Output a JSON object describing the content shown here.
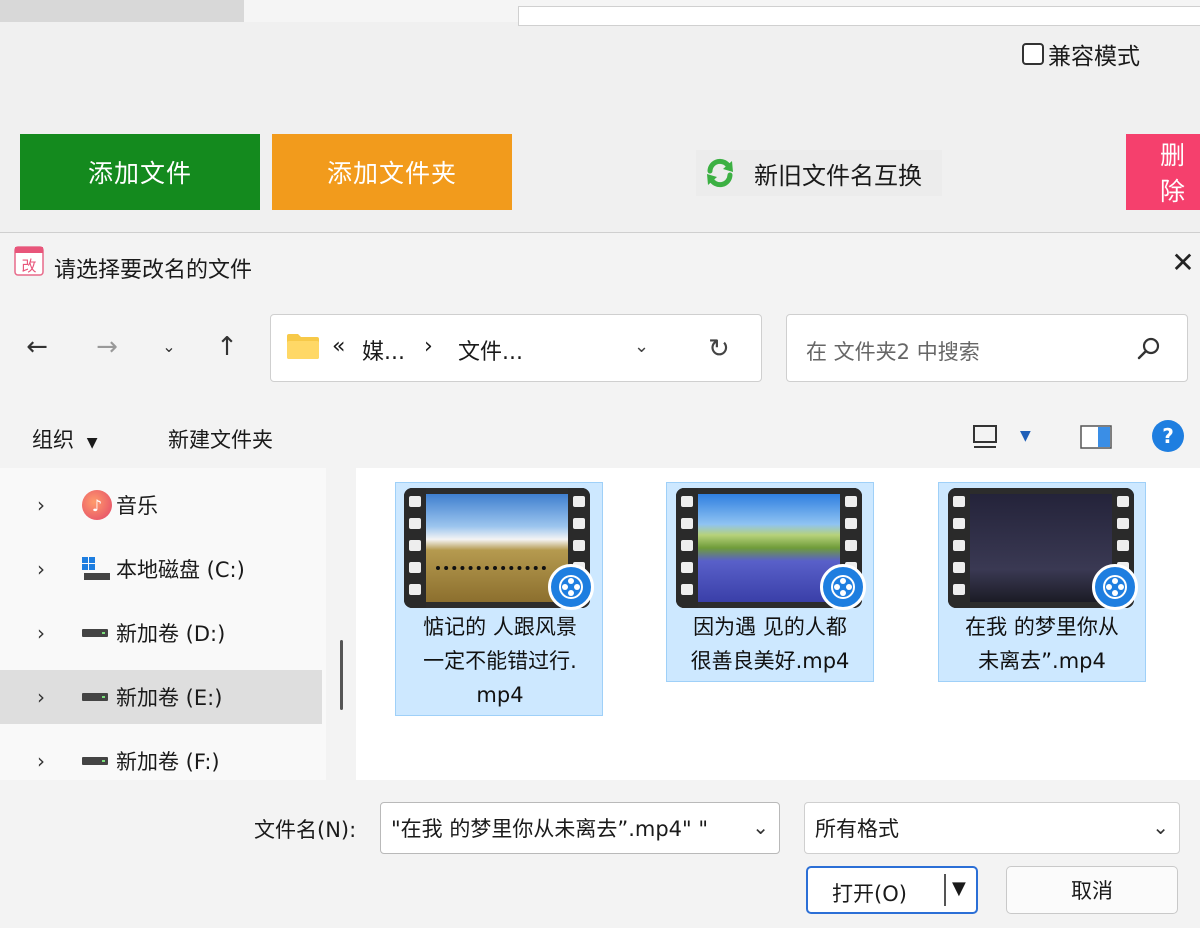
{
  "background_app": {
    "compat_mode_label": "兼容模式",
    "buttons": {
      "add_file": "添加文件",
      "add_folder": "添加文件夹",
      "swap_names": "新旧文件名互换",
      "delete_partial": "删除"
    },
    "colors": {
      "green": "#148a1e",
      "orange": "#f29b1c",
      "pink": "#f5406d"
    }
  },
  "dialog": {
    "title": "请选择要改名的文件",
    "address": {
      "prefix": "«",
      "segment1": "媒...",
      "separator": "›",
      "segment2": "文件..."
    },
    "search_placeholder": "在 文件夹2 中搜索",
    "toolbar": {
      "organize": "组织",
      "new_folder": "新建文件夹"
    },
    "nav_tree": [
      {
        "label": "音乐",
        "icon": "music-icon"
      },
      {
        "label": "本地磁盘 (C:)",
        "icon": "system-drive-icon"
      },
      {
        "label": "新加卷 (D:)",
        "icon": "drive-icon"
      },
      {
        "label": "新加卷 (E:)",
        "icon": "drive-icon"
      },
      {
        "label": "新加卷 (F:)",
        "icon": "drive-icon"
      }
    ],
    "files": [
      {
        "name_line1": "惦记的 人跟风景",
        "name_line2": "一定不能错过行.",
        "name_line3": "mp4"
      },
      {
        "name_line1": "因为遇 见的人都",
        "name_line2": "很善良美好.mp4"
      },
      {
        "name_line1": "在我 的梦里你从",
        "name_line2": "未离去”.mp4"
      }
    ],
    "filename_label": "文件名(N):",
    "filename_value": "\"在我 的梦里你从未离去”.mp4\" \"",
    "filetype_value": "所有格式",
    "open_button": "打开(O)",
    "cancel_button": "取消"
  }
}
